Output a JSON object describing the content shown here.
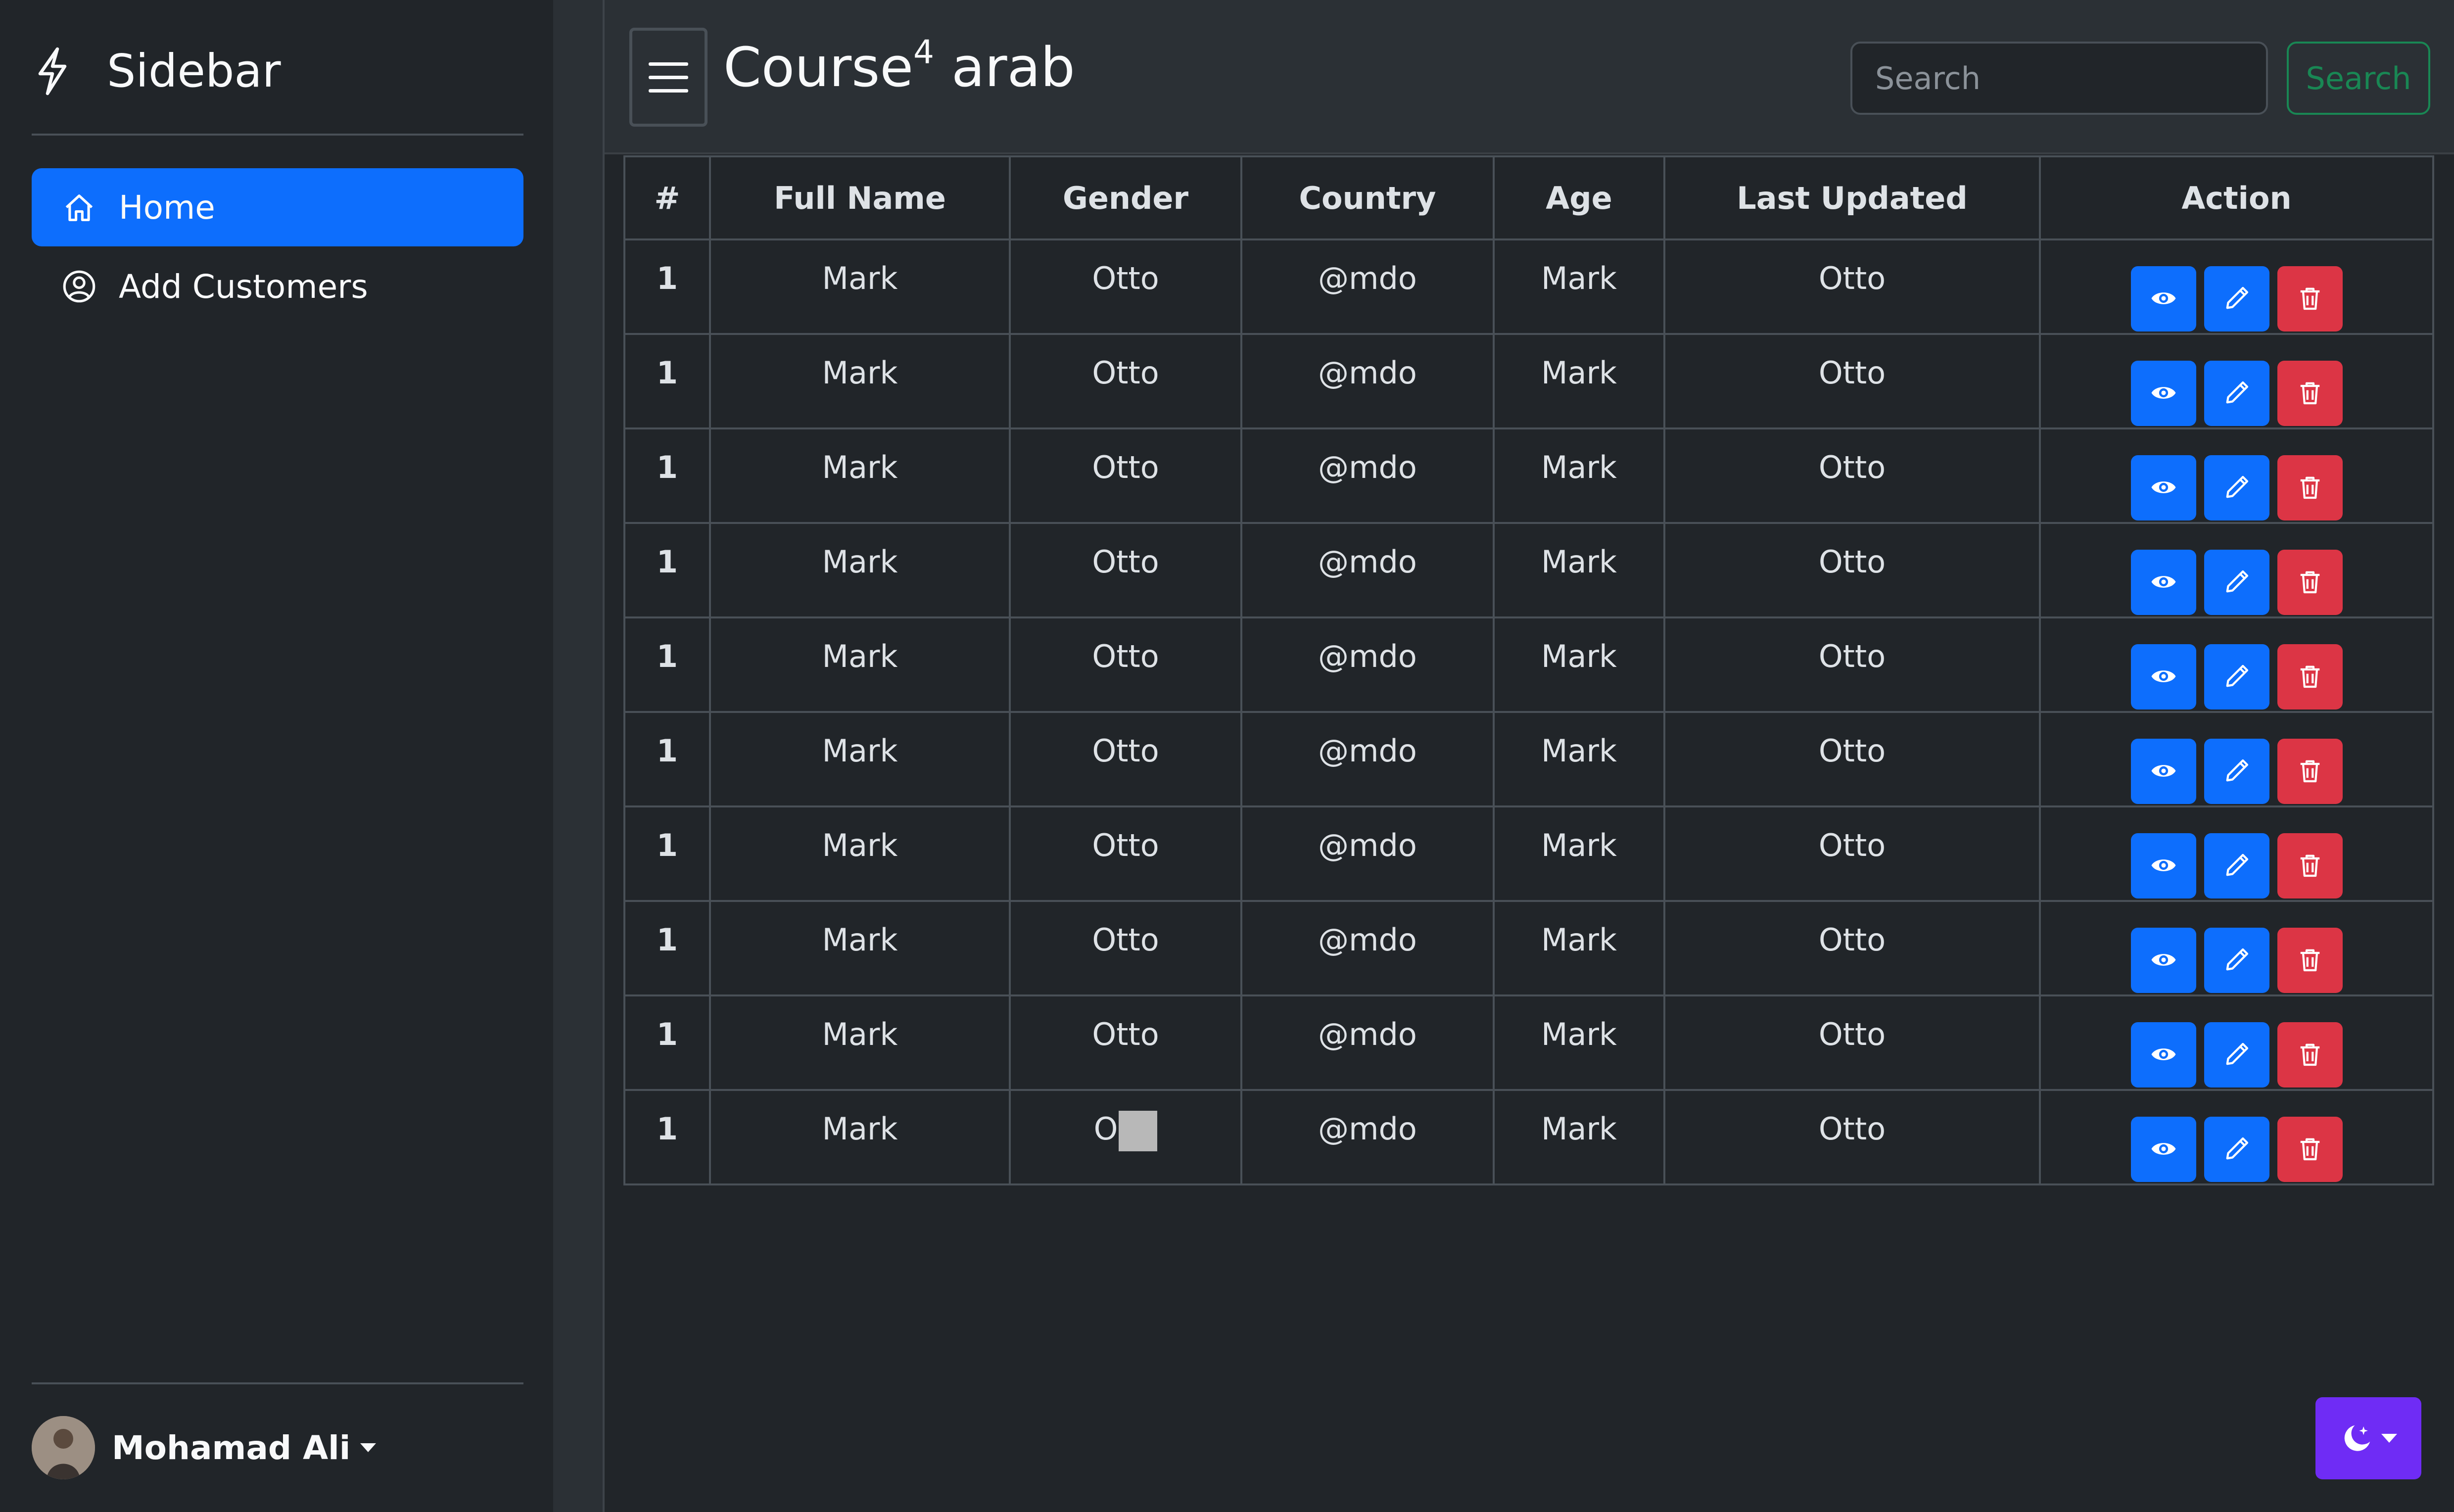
{
  "sidebar": {
    "brand": "Sidebar",
    "items": [
      {
        "label": "Home",
        "icon": "home-icon",
        "active": true
      },
      {
        "label": "Add Customers",
        "icon": "user-circle-icon",
        "active": false
      }
    ],
    "user": {
      "name": "Mohamad Ali"
    }
  },
  "header": {
    "title_main": "Course",
    "title_sup": "4",
    "title_rest": " arab",
    "search_placeholder": "Search",
    "search_button": "Search"
  },
  "table": {
    "columns": [
      "#",
      "Full Name",
      "Gender",
      "Country",
      "Age",
      "Last Updated",
      "Action"
    ],
    "rows": [
      [
        "1",
        "Mark",
        "Otto",
        "@mdo",
        "Mark",
        "Otto"
      ],
      [
        "1",
        "Mark",
        "Otto",
        "@mdo",
        "Mark",
        "Otto"
      ],
      [
        "1",
        "Mark",
        "Otto",
        "@mdo",
        "Mark",
        "Otto"
      ],
      [
        "1",
        "Mark",
        "Otto",
        "@mdo",
        "Mark",
        "Otto"
      ],
      [
        "1",
        "Mark",
        "Otto",
        "@mdo",
        "Mark",
        "Otto"
      ],
      [
        "1",
        "Mark",
        "Otto",
        "@mdo",
        "Mark",
        "Otto"
      ],
      [
        "1",
        "Mark",
        "Otto",
        "@mdo",
        "Mark",
        "Otto"
      ],
      [
        "1",
        "Mark",
        "Otto",
        "@mdo",
        "Mark",
        "Otto"
      ],
      [
        "1",
        "Mark",
        "Otto",
        "@mdo",
        "Mark",
        "Otto"
      ],
      [
        "1",
        "Mark",
        "O",
        "@mdo",
        "Mark",
        "Otto"
      ]
    ],
    "action_icons": [
      "eye-icon",
      "pencil-icon",
      "trash-icon"
    ]
  },
  "theme_toggle": {
    "icon": "moon-stars-icon"
  },
  "colors": {
    "primary": "#0d6efd",
    "danger": "#dc3545",
    "success": "#198754",
    "theme_button": "#6f2cf5",
    "background": "#212529"
  }
}
